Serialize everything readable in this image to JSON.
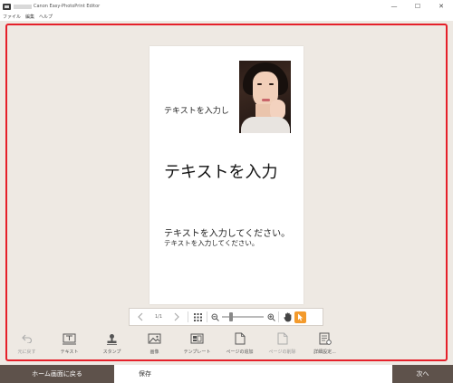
{
  "window": {
    "title": "Canon Easy-PhotoPrint Editor",
    "controls": {
      "minimize": "—",
      "maximize": "☐",
      "close": "✕"
    }
  },
  "menu": [
    "ファイル",
    "編集",
    "ヘルプ"
  ],
  "page": {
    "text_small": "テキストを入力し",
    "text_big": "テキストを入力",
    "text_mid": "テキストを入力してください。",
    "text_sub": "テキストを入力してください。"
  },
  "page_toolbar": {
    "page_count": "1/1",
    "zoom_level": 0.2,
    "icons": [
      "chevron-left-icon",
      "chevron-right-icon",
      "grid-icon",
      "zoom-out-icon",
      "zoom-in-icon",
      "hand-icon",
      "pointer-icon"
    ]
  },
  "tools": [
    {
      "label": "元に戻す",
      "icon": "undo-icon",
      "enabled": false
    },
    {
      "label": "テキスト",
      "icon": "text-icon",
      "enabled": true
    },
    {
      "label": "スタンプ",
      "icon": "stamp-icon",
      "enabled": true
    },
    {
      "label": "画像",
      "icon": "image-icon",
      "enabled": true
    },
    {
      "label": "テンプレート",
      "icon": "template-icon",
      "enabled": true
    },
    {
      "label": "ページの追加",
      "icon": "add-page-icon",
      "enabled": true
    },
    {
      "label": "ページの削除",
      "icon": "delete-page-icon",
      "enabled": false
    },
    {
      "label": "詳細設定...",
      "icon": "advanced-settings-icon",
      "enabled": true
    }
  ],
  "footer": {
    "home_label": "ホーム画面に戻る",
    "save_label": "保存",
    "next_label": "次へ"
  },
  "colors": {
    "highlight_frame": "#e5202a",
    "workspace_bg": "#eee9e3",
    "footer_button": "#5e524b",
    "pointer_active": "#f39a2c"
  }
}
